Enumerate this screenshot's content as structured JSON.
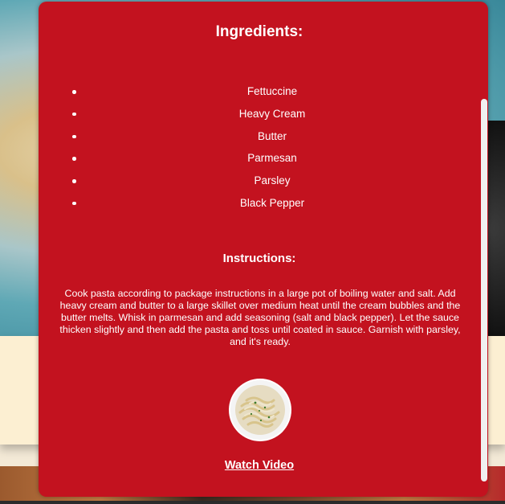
{
  "recipe": {
    "ingredients_heading": "Ingredients:",
    "ingredients": [
      "Fettuccine",
      "Heavy Cream",
      "Butter",
      "Parmesan",
      "Parsley",
      "Black Pepper"
    ],
    "instructions_heading": "Instructions:",
    "instructions": "Cook pasta according to package instructions in a large pot of boiling water and salt. Add heavy cream and butter to a large skillet over medium heat until the cream bubbles and the butter melts. Whisk in parmesan and add seasoning (salt and black pepper). Let the sauce thicken slightly and then add the pasta and toss until coated in sauce. Garnish with parsley, and it's ready.",
    "watch_video_label": "Watch Video"
  },
  "colors": {
    "modal_bg": "#c3121f",
    "text": "#ffffff"
  }
}
